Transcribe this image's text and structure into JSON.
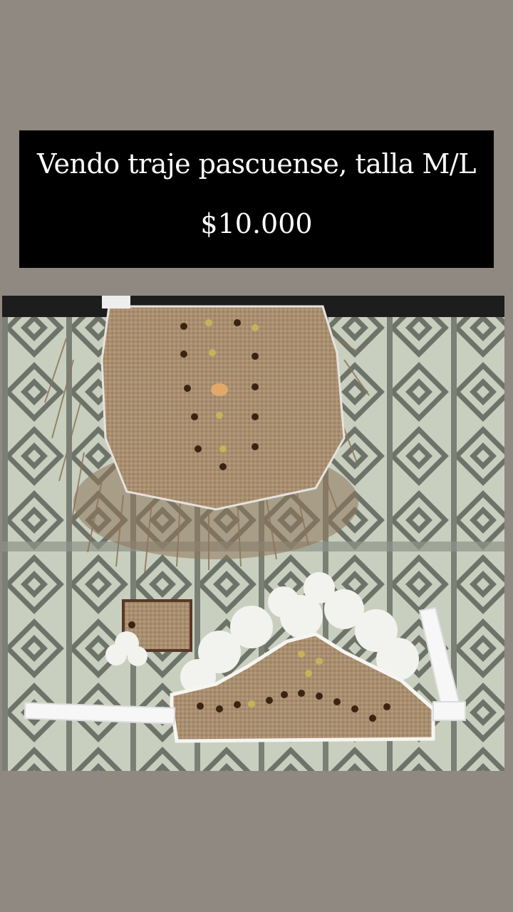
{
  "caption": {
    "line1": "Vendo traje pascuense, talla M/L",
    "line2": "$10.000"
  },
  "photo": {
    "subject": "burlap-costume-photo",
    "colors": {
      "background": "#8f8981",
      "caption_bg": "#000000",
      "caption_text": "#ffffff",
      "blanket_light": "#c9cfbf",
      "blanket_pattern": "#6e7369",
      "burlap": "#a98f70",
      "fringe": "#8d7559",
      "sequin": "#3b2312",
      "feather": "#f2f2ef"
    }
  }
}
